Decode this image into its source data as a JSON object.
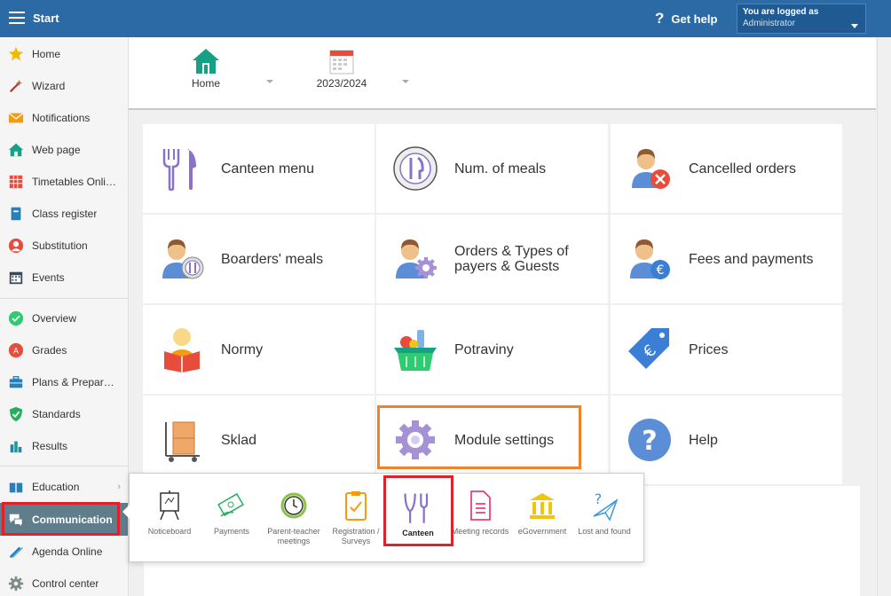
{
  "topbar": {
    "title": "Start",
    "help_label": "Get help",
    "user_line1": "You are logged as",
    "user_line2": "Administrator"
  },
  "sidebar": {
    "items": [
      {
        "label": "Home",
        "icon": "star-icon"
      },
      {
        "label": "Wizard",
        "icon": "wand-icon"
      },
      {
        "label": "Notifications",
        "icon": "envelope-icon"
      },
      {
        "label": "Web page",
        "icon": "house-icon"
      },
      {
        "label": "Timetables Online",
        "icon": "timetable-icon"
      },
      {
        "label": "Class register",
        "icon": "book-icon"
      },
      {
        "label": "Substitution",
        "icon": "person-icon"
      },
      {
        "label": "Events",
        "icon": "calendar-icon"
      },
      {
        "label": "Overview",
        "icon": "check-circle-icon"
      },
      {
        "label": "Grades",
        "icon": "grade-icon"
      },
      {
        "label": "Plans & Preparations",
        "icon": "briefcase-icon"
      },
      {
        "label": "Standards",
        "icon": "shield-icon"
      },
      {
        "label": "Results",
        "icon": "bar-chart-icon"
      },
      {
        "label": "Education",
        "icon": "books-icon"
      },
      {
        "label": "Communication",
        "icon": "chat-icon"
      },
      {
        "label": "Agenda Online",
        "icon": "pencil-icon"
      },
      {
        "label": "Control center",
        "icon": "gear-icon"
      }
    ]
  },
  "header": {
    "home_label": "Home",
    "year_label": "2023/2024"
  },
  "tiles": [
    {
      "label": "Canteen menu",
      "icon": "fork-knife-icon"
    },
    {
      "label": "Num. of meals",
      "icon": "plate-icon"
    },
    {
      "label": "Cancelled orders",
      "icon": "person-cancel-icon"
    },
    {
      "label": "Boarders' meals",
      "icon": "person-plate-icon"
    },
    {
      "label": "Orders & Types of payers & Guests",
      "icon": "person-gear-icon"
    },
    {
      "label": "Fees and payments",
      "icon": "person-euro-icon"
    },
    {
      "label": "Normy",
      "icon": "reader-icon"
    },
    {
      "label": "Potraviny",
      "icon": "basket-icon"
    },
    {
      "label": "Prices",
      "icon": "price-tag-icon"
    },
    {
      "label": "Sklad",
      "icon": "boxes-cart-icon"
    },
    {
      "label": "Module settings",
      "icon": "gear-icon"
    },
    {
      "label": "Help",
      "icon": "help-icon"
    }
  ],
  "popup": {
    "items": [
      {
        "label": "Noticeboard",
        "icon": "noticeboard-icon"
      },
      {
        "label": "Payments",
        "icon": "money-icon"
      },
      {
        "label": "Parent-teacher meetings",
        "icon": "timer-icon"
      },
      {
        "label": "Registration / Surveys",
        "icon": "clipboard-icon"
      },
      {
        "label": "Canteen",
        "icon": "cutlery-icon"
      },
      {
        "label": "Meeting records",
        "icon": "document-icon"
      },
      {
        "label": "eGovernment",
        "icon": "government-icon"
      },
      {
        "label": "Lost and found",
        "icon": "question-plane-icon"
      }
    ]
  },
  "colors": {
    "topbar": "#2b6aa5",
    "active_sidebar": "#607d8b",
    "highlight_red": "#e0202a",
    "highlight_orange": "#f0832a",
    "icon_purple": "#8a72c8"
  }
}
